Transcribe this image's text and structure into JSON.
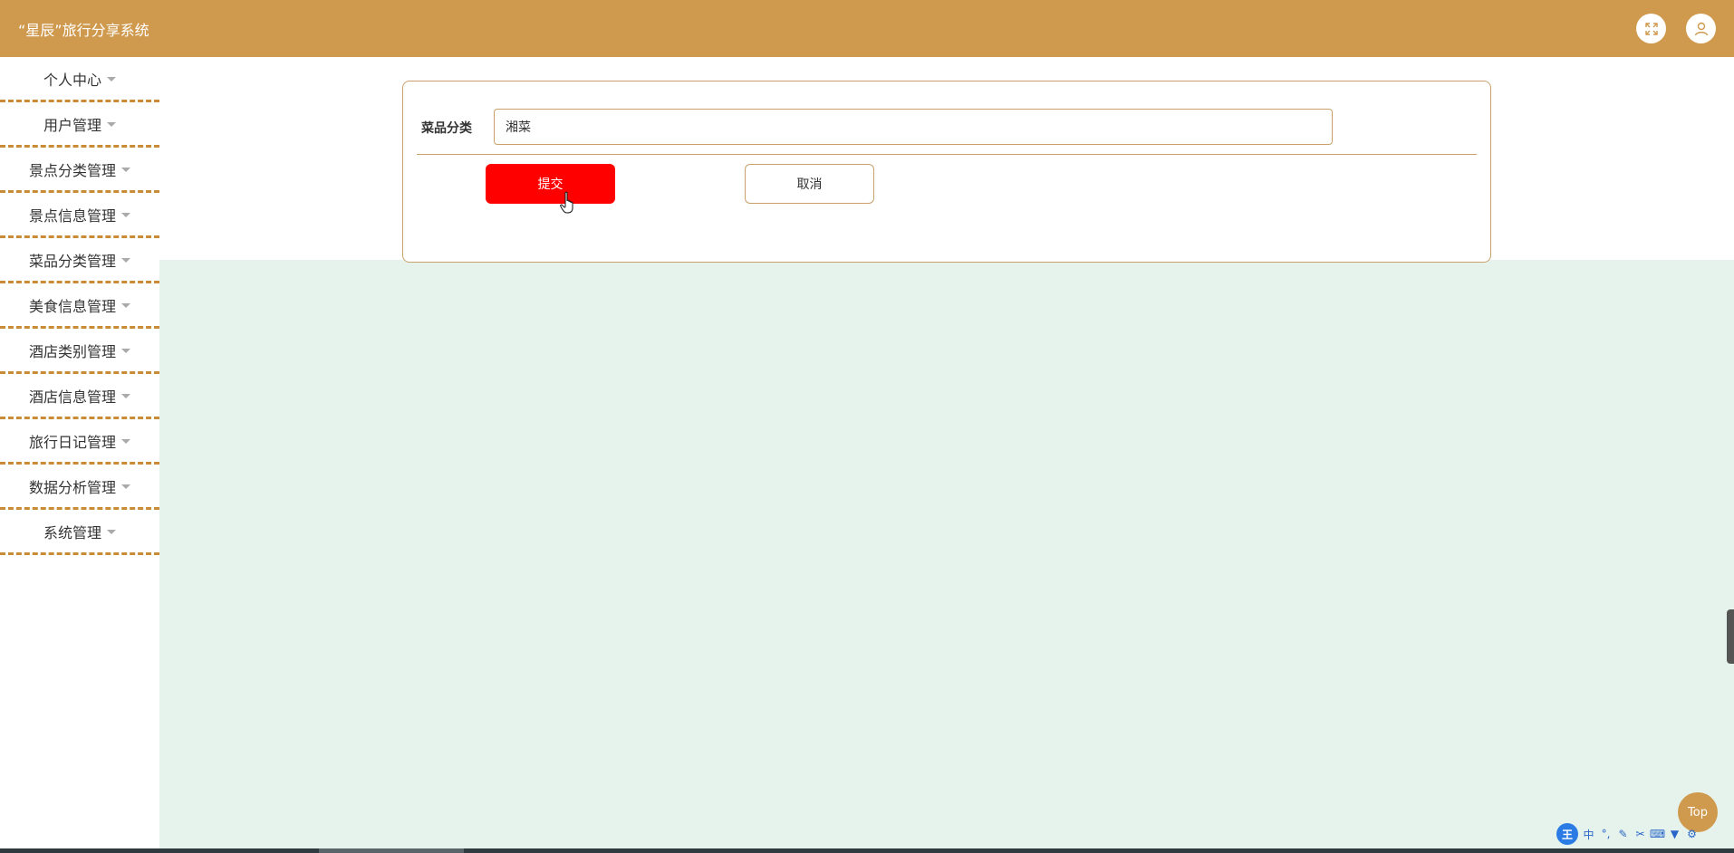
{
  "header": {
    "title": "“星辰”旅行分享系统",
    "fullscreen_icon": "expand-icon",
    "user_icon": "user-icon"
  },
  "sidebar": {
    "items": [
      {
        "label": "个人中心"
      },
      {
        "label": "用户管理"
      },
      {
        "label": "景点分类管理"
      },
      {
        "label": "景点信息管理"
      },
      {
        "label": "菜品分类管理"
      },
      {
        "label": "美食信息管理"
      },
      {
        "label": "酒店类别管理"
      },
      {
        "label": "酒店信息管理"
      },
      {
        "label": "旅行日记管理"
      },
      {
        "label": "数据分析管理"
      },
      {
        "label": "系统管理"
      }
    ]
  },
  "form": {
    "field_label": "菜品分类",
    "field_value": "湘菜",
    "submit_label": "提交",
    "cancel_label": "取消"
  },
  "float": {
    "top_label": "Top"
  },
  "ime": {
    "logo": "王",
    "mode": "中"
  },
  "colors": {
    "header": "#cf9a4e",
    "submit": "#ff0000",
    "content_bg": "#e5f3ec",
    "border": "#c9a16c"
  }
}
